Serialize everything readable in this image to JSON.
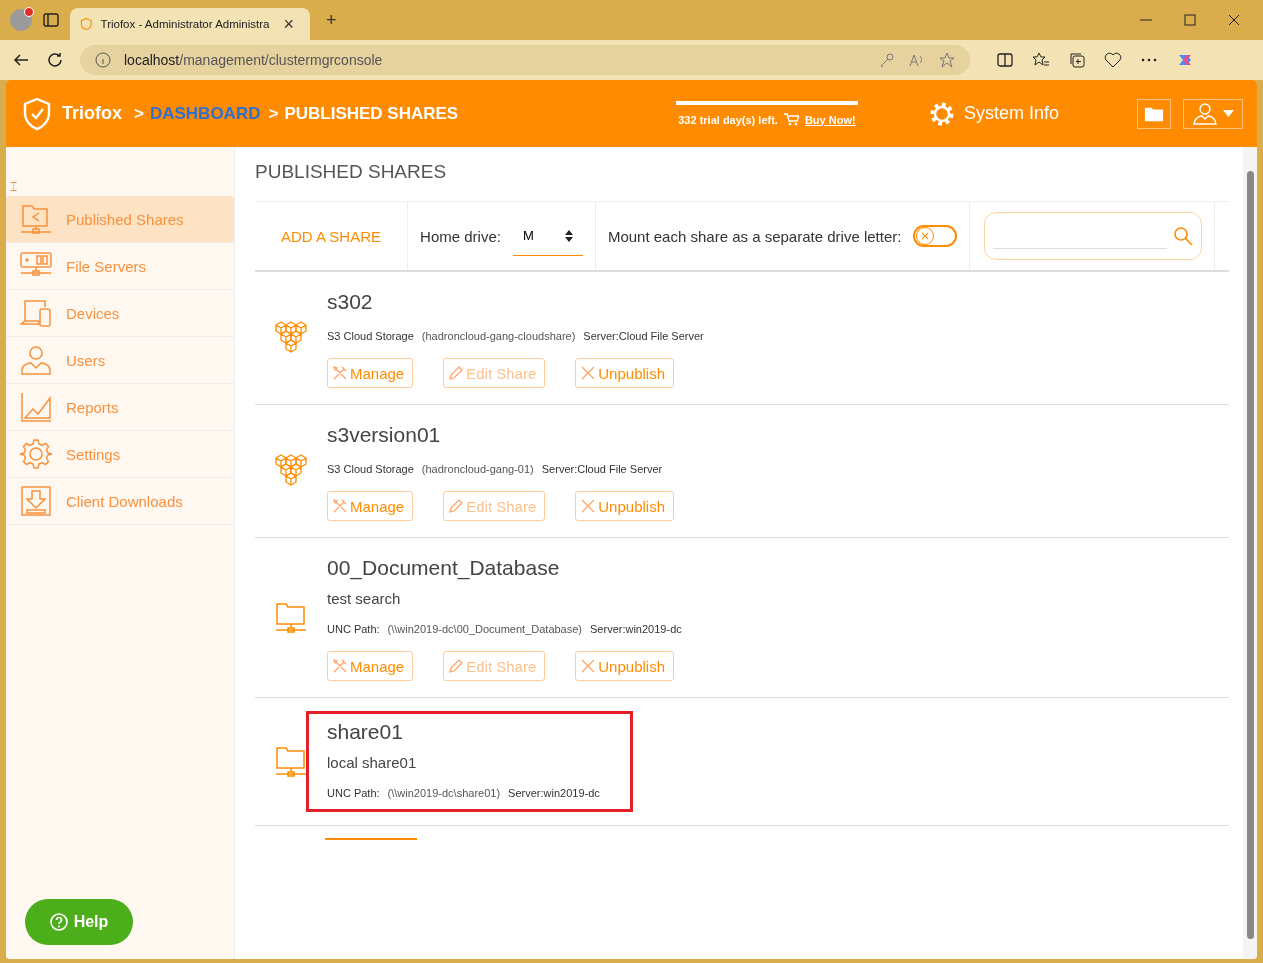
{
  "browser": {
    "tab_title": "Triofox - Administrator Administra",
    "close_glyph": "×",
    "new_tab_glyph": "+",
    "url_host": "localhost",
    "url_path": "/management/clustermgrconsole"
  },
  "header": {
    "brand": "Triofox",
    "crumb_sep_1": ">",
    "crumb_link": "DASHBOARD",
    "crumb_sep_2": ">",
    "crumb_current": "PUBLISHED SHARES",
    "trial": "332 trial day(s) left.",
    "buy": "Buy Now!",
    "system_info": "System Info"
  },
  "sidebar": {
    "collapse_glyph": "⌶",
    "items": [
      {
        "kind": "shares",
        "label": "Published Shares",
        "selected": true
      },
      {
        "kind": "servers",
        "label": "File Servers",
        "selected": false
      },
      {
        "kind": "devices",
        "label": "Devices",
        "selected": false
      },
      {
        "kind": "users",
        "label": "Users",
        "selected": false
      },
      {
        "kind": "reports",
        "label": "Reports",
        "selected": false
      },
      {
        "kind": "settings",
        "label": "Settings",
        "selected": false
      },
      {
        "kind": "downloads",
        "label": "Client Downloads",
        "selected": false
      }
    ]
  },
  "help": {
    "label": "Help"
  },
  "page_title": "PUBLISHED SHARES",
  "toolbar": {
    "add": "ADD A SHARE",
    "home_drive_label": "Home drive:",
    "home_drive_value": "M",
    "mount_label": "Mount each share as a separate drive letter:",
    "mount_on": false
  },
  "shares": [
    {
      "kind": "s3",
      "name": "s302",
      "info_label": "S3 Cloud Storage",
      "path": "(hadroncloud-gang-cloudshare)",
      "server": "Server:Cloud File Server",
      "buttons": [
        "Manage",
        "Edit Share",
        "Unpublish"
      ],
      "highlighted": false
    },
    {
      "kind": "s3",
      "name": "s3version01",
      "info_label": "S3 Cloud Storage",
      "path": "(hadroncloud-gang-01)",
      "server": "Server:Cloud File Server",
      "buttons": [
        "Manage",
        "Edit Share",
        "Unpublish"
      ],
      "highlighted": false
    },
    {
      "kind": "folder",
      "name": "00_Document_Database",
      "description": "test search",
      "info_label": "UNC Path:",
      "path": "(\\\\win2019-dc\\00_Document_Database)",
      "server": "Server:win2019-dc",
      "buttons": [
        "Manage",
        "Edit Share",
        "Unpublish"
      ],
      "highlighted": false
    },
    {
      "kind": "folder",
      "name": "share01",
      "description": "local share01",
      "info_label": "UNC Path:",
      "path": "(\\\\win2019-dc\\share01)",
      "server": "Server:win2019-dc",
      "highlighted": true
    }
  ]
}
